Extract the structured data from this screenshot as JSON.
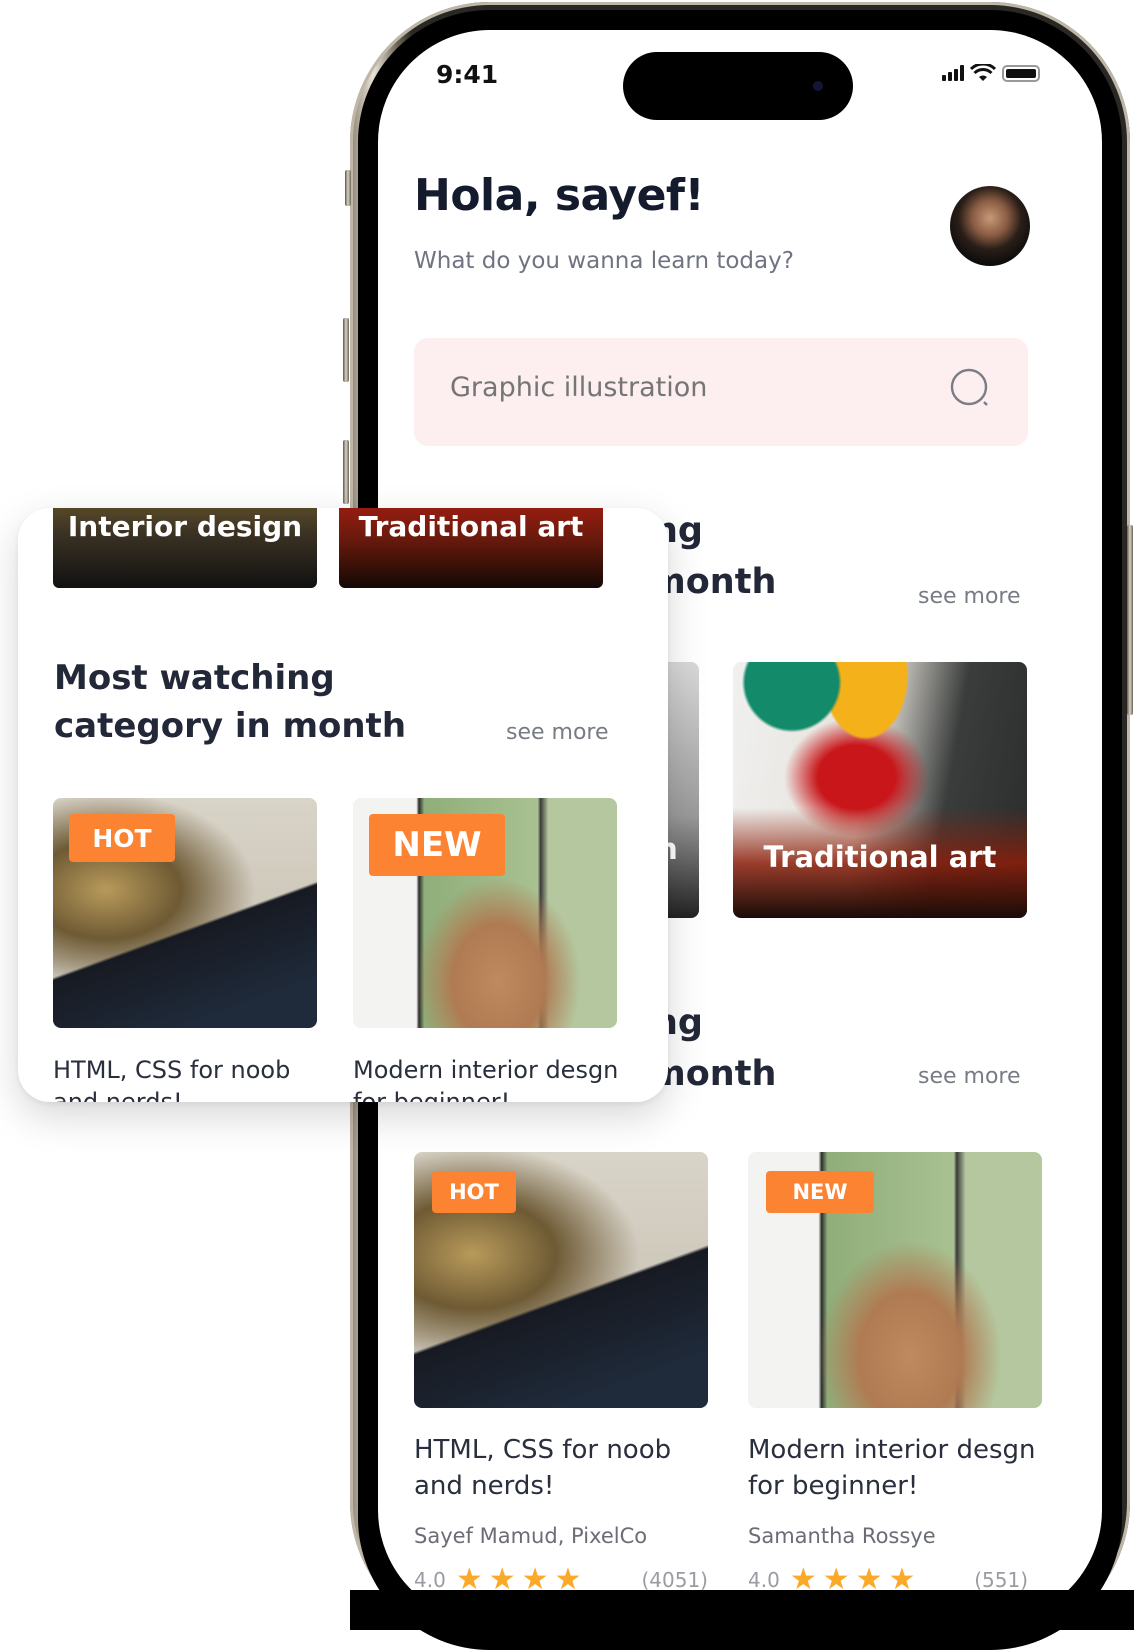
{
  "status_bar": {
    "time": "9:41",
    "icons": [
      "signal-icon",
      "wifi-icon",
      "battery-icon"
    ]
  },
  "header": {
    "greeting": "Hola, sayef!",
    "subtitle": "What do you wanna learn today?",
    "avatar": "user-avatar"
  },
  "search": {
    "placeholder": "Graphic illustration",
    "icon": "search-icon"
  },
  "category_section": {
    "title_line1": "Most watching",
    "title_line2": "category in month",
    "title_visible_fragment_1": "gory",
    "title_visible_fragment_2": "m",
    "see_more": "see more",
    "items": [
      {
        "label": "Interior design",
        "partial_visible": "n"
      },
      {
        "label": "Traditional art"
      }
    ]
  },
  "course_section": {
    "title_line1": "Most watching",
    "title_line2": "category in month",
    "title_visible_fragment_1": "g",
    "title_visible_fragment_2": "onth",
    "see_more": "see more",
    "courses": [
      {
        "badge": "HOT",
        "title_line1": "HTML, CSS for noob",
        "title_line2": "and nerds!",
        "author": "Sayef Mamud, PixelCo",
        "rating": "4.0",
        "stars": 4,
        "reviews": "(4051)"
      },
      {
        "badge": "NEW",
        "title_line1": "Modern interior desgn",
        "title_line2": "for beginner!",
        "author": "Samantha Rossye",
        "rating": "4.0",
        "stars": 4,
        "reviews": "(551)"
      }
    ]
  },
  "popup": {
    "categories": [
      {
        "label": "Interior design"
      },
      {
        "label": "Traditional art"
      }
    ],
    "section_title_line1": "Most watching",
    "section_title_line2": "category in month",
    "see_more": "see more",
    "courses": [
      {
        "badge": "HOT",
        "title_line1": "HTML, CSS for noob",
        "title_line2": "and nerds!"
      },
      {
        "badge": "NEW",
        "title_line1": "Modern interior desgn",
        "title_line2": "for beginner!"
      }
    ]
  },
  "colors": {
    "badge": "#fb8332",
    "star": "#fca828",
    "search_bg": "#fdeef0",
    "heading": "#232838"
  }
}
